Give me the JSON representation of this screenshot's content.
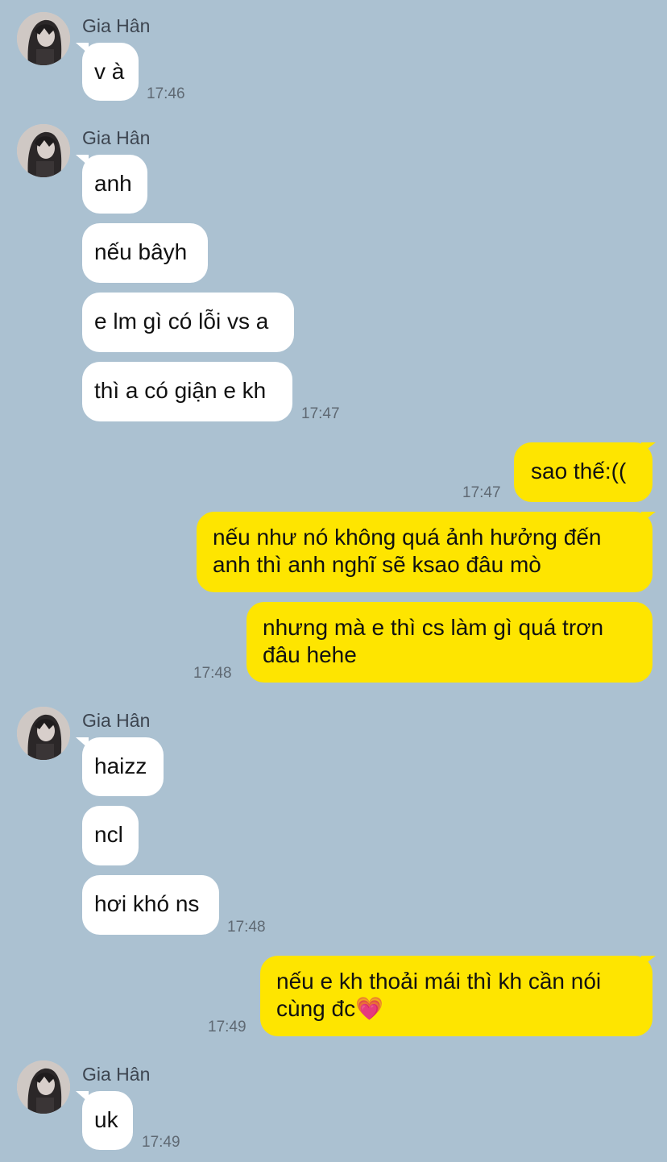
{
  "contact": {
    "name": "Gia Hân"
  },
  "colors": {
    "background": "#abc1d1",
    "incoming": "#ffffff",
    "outgoing": "#fee500"
  },
  "groups": [
    {
      "sender": "Gia Hân",
      "messages": [
        "v à"
      ],
      "time": "17:46"
    },
    {
      "sender": "Gia Hân",
      "messages": [
        "anh",
        "nếu bâyh",
        "e lm gì có lỗi vs a",
        "thì a có giận e kh"
      ],
      "time": "17:47"
    },
    {
      "sender": "me",
      "messages": [
        "sao thế:(("
      ],
      "time": "17:47"
    },
    {
      "sender": "me",
      "messages": [
        "nếu như nó không quá ảnh hưởng đến\nanh thì anh nghĩ sẽ ksao đâu mò",
        "nhưng mà e thì cs làm gì quá trơn\nđâu hehe"
      ],
      "time": "17:48"
    },
    {
      "sender": "Gia Hân",
      "messages": [
        "haizz",
        "ncl",
        "hơi khó ns"
      ],
      "time": "17:48"
    },
    {
      "sender": "me",
      "messages": [
        "nếu e kh thoải mái thì kh cần nói\ncùng đc💗"
      ],
      "time": "17:49"
    },
    {
      "sender": "Gia Hân",
      "messages": [
        "uk"
      ],
      "time": "17:49"
    }
  ]
}
